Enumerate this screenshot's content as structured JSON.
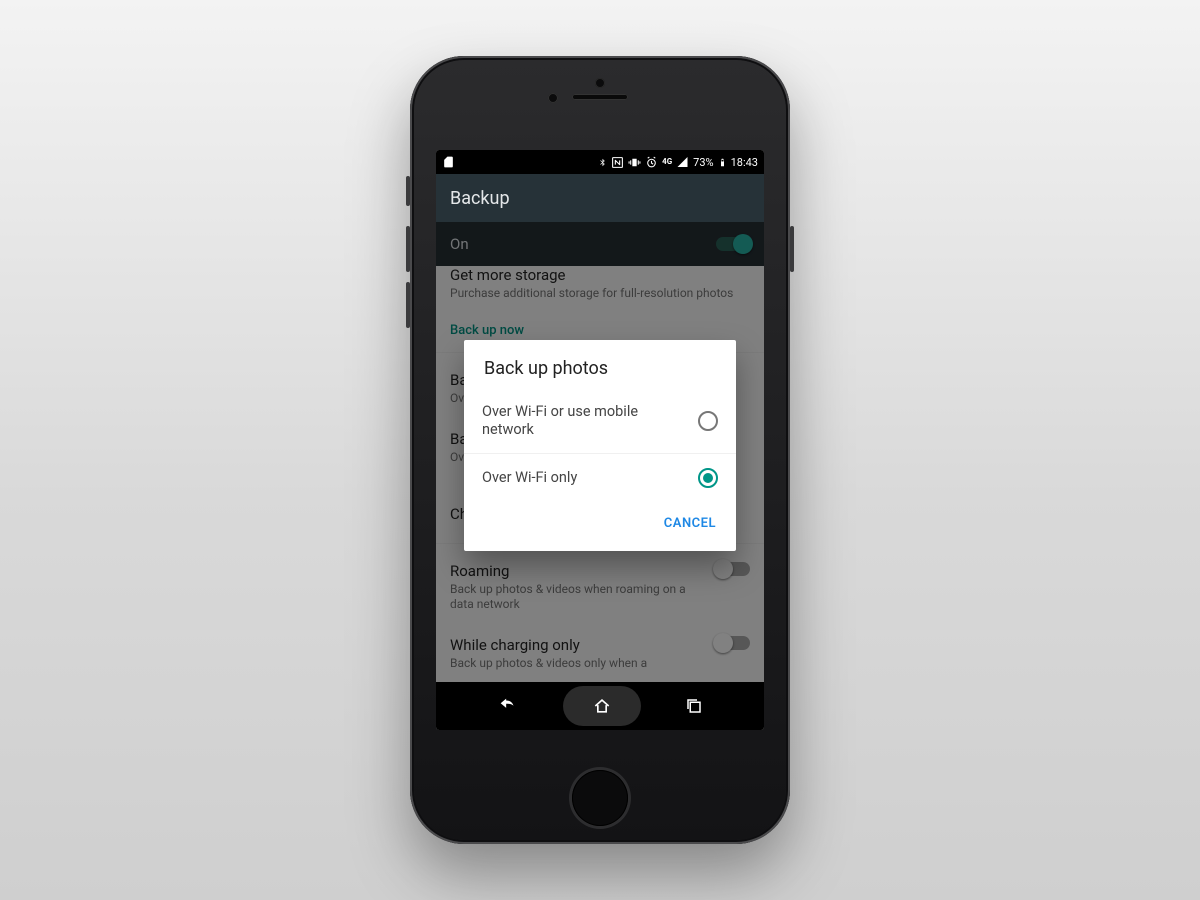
{
  "statusbar": {
    "battery_text": "73%",
    "time": "18:43",
    "network_label": "4G"
  },
  "header": {
    "title": "Backup"
  },
  "toggle": {
    "label": "On",
    "on": true
  },
  "list": {
    "storage": {
      "title": "Get more storage",
      "sub": "Purchase additional storage for full-resolution photos"
    },
    "backup_now": "Back up now",
    "photos": {
      "title": "Back up photos",
      "sub": "Over Wi-Fi only"
    },
    "videos": {
      "title": "Back up videos",
      "sub": "Over Wi-Fi only"
    },
    "charger": {
      "title": "Charger only"
    },
    "roaming": {
      "title": "Roaming",
      "sub": "Back up photos & videos when roaming on a data network",
      "on": false
    },
    "charging": {
      "title": "While charging only",
      "sub": "Back up photos & videos only when a",
      "on": false
    }
  },
  "dialog": {
    "title": "Back up photos",
    "options": [
      {
        "label": "Over Wi-Fi or use mobile network",
        "selected": false
      },
      {
        "label": "Over Wi-Fi only",
        "selected": true
      }
    ],
    "cancel": "CANCEL"
  },
  "colors": {
    "accent": "#009688",
    "header": "#263238",
    "action": "#1e88e5"
  }
}
